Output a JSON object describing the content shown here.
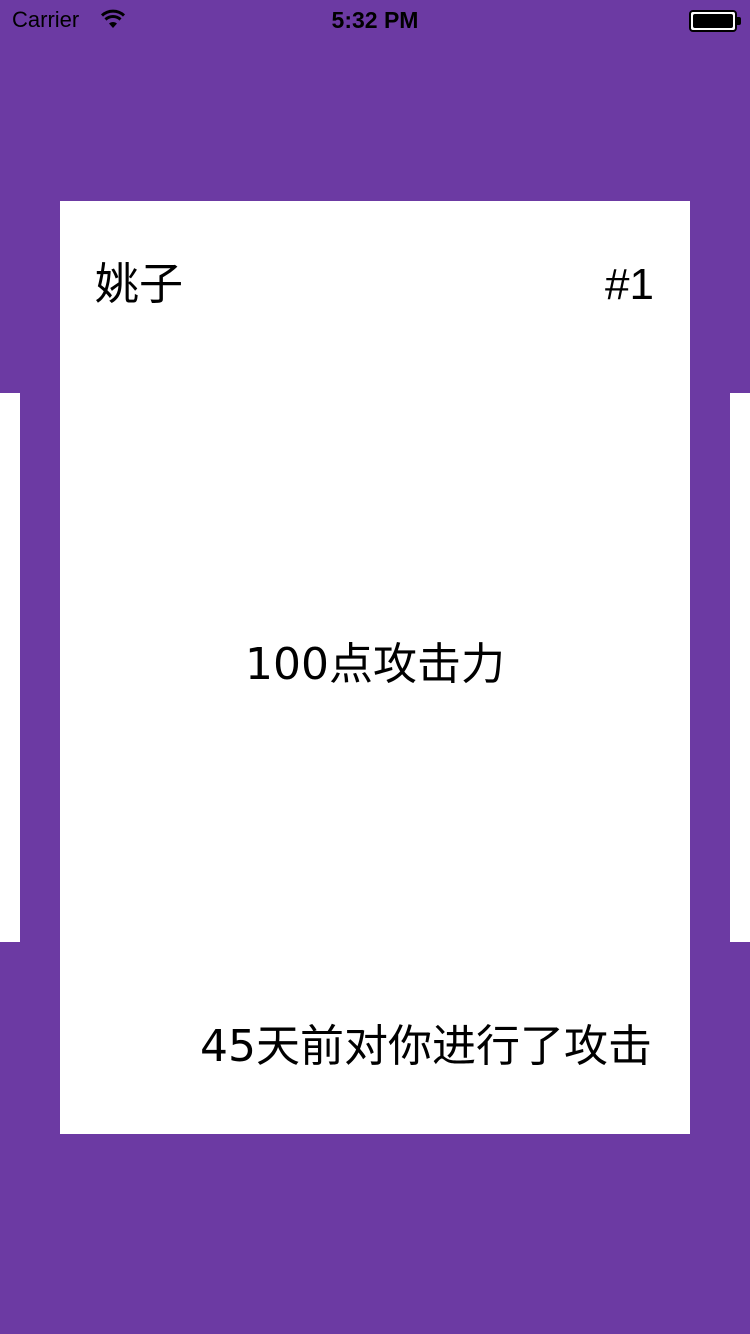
{
  "status_bar": {
    "carrier": "Carrier",
    "time": "5:32 PM",
    "wifi_icon": "wifi-icon",
    "battery_icon": "battery-full-icon"
  },
  "colors": {
    "background": "#6c3aa3",
    "card": "#ffffff",
    "text": "#000000"
  },
  "card": {
    "name": "姚子",
    "number": "#1",
    "content": "100点攻击力",
    "footer": "45天前对你进行了攻击"
  }
}
